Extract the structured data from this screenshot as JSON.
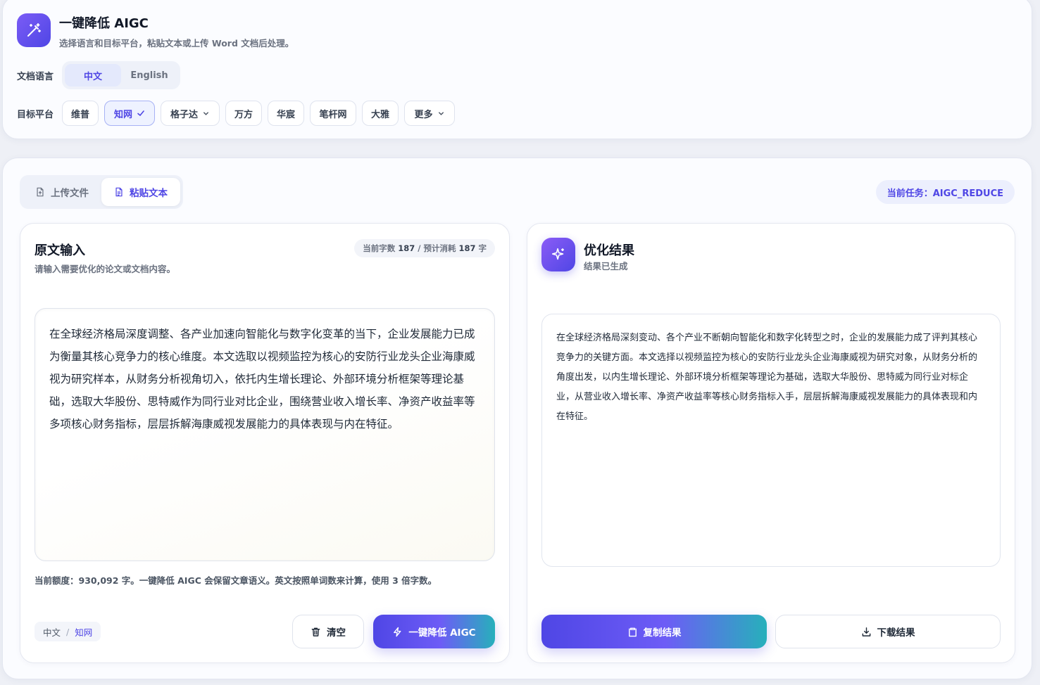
{
  "header": {
    "title": "一键降低 AIGC",
    "subtitle": "选择语言和目标平台，粘贴文本或上传 Word 文档后处理。"
  },
  "language": {
    "label": "文档语言",
    "options": [
      "中文",
      "English"
    ],
    "selected": "中文"
  },
  "platform": {
    "label": "目标平台",
    "options": [
      {
        "label": "维普",
        "selected": false,
        "dropdown": false
      },
      {
        "label": "知网",
        "selected": true,
        "dropdown": false
      },
      {
        "label": "格子达",
        "selected": false,
        "dropdown": true
      },
      {
        "label": "万方",
        "selected": false,
        "dropdown": false
      },
      {
        "label": "华宸",
        "selected": false,
        "dropdown": false
      },
      {
        "label": "笔杆网",
        "selected": false,
        "dropdown": false
      },
      {
        "label": "大雅",
        "selected": false,
        "dropdown": false
      },
      {
        "label": "更多",
        "selected": false,
        "dropdown": true
      }
    ]
  },
  "source_tabs": {
    "upload": "上传文件",
    "paste": "粘贴文本",
    "active": "paste"
  },
  "task": {
    "label": "当前任务：AIGC_REDUCE"
  },
  "input_panel": {
    "title": "原文输入",
    "subtitle": "请输入需要优化的论文或文档内容。",
    "count_prefix": "当前字数",
    "count": "187",
    "cost_prefix": "/ 预计消耗",
    "cost": "187",
    "cost_unit": "字",
    "text": "在全球经济格局深度调整、各产业加速向智能化与数字化变革的当下，企业发展能力已成为衡量其核心竞争力的核心维度。本文选取以视频监控为核心的安防行业龙头企业海康威视为研究样本，从财务分析视角切入，依托内生增长理论、外部环境分析框架等理论基础，选取大华股份、思特威作为同行业对比企业，围绕营业收入增长率、净资产收益率等多项核心财务指标，层层拆解海康威视发展能力的具体表现与内在特征。",
    "quota_note": "当前额度：930,092 字。一键降低 AIGC 会保留文章语义。英文按照单词数来计算，使用 3 倍字数。",
    "crumb_lang": "中文",
    "crumb_sep": "/",
    "crumb_platform": "知网",
    "clear_label": "清空",
    "run_label": "一键降低 AIGC"
  },
  "result_panel": {
    "title": "优化结果",
    "subtitle": "结果已生成",
    "text": "在全球经济格局深刻变动、各个产业不断朝向智能化和数字化转型之时，企业的发展能力成了评判其核心竞争力的关键方面。本文选择以视频监控为核心的安防行业龙头企业海康威视为研究对象，从财务分析的角度出发，以内生增长理论、外部环境分析框架等理论为基础，选取大华股份、思特威为同行业对标企业，从营业收入增长率、净资产收益率等核心财务指标入手，层层拆解海康威视发展能力的具体表现和内在特征。",
    "copy_label": "复制结果",
    "download_label": "下载结果"
  },
  "colors": {
    "accent": "#4f46e5",
    "accent_soft": "#eef2ff",
    "teal": "#27b0bb"
  }
}
